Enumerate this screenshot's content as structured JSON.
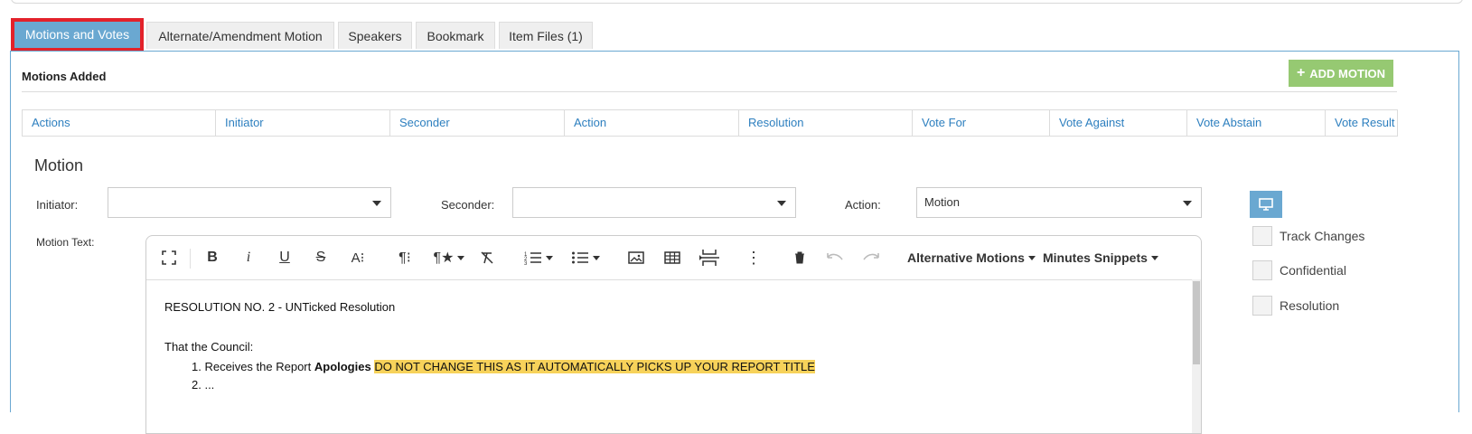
{
  "tabs": [
    {
      "label": "Motions and Votes",
      "active": true
    },
    {
      "label": "Alternate/Amendment Motion"
    },
    {
      "label": "Speakers"
    },
    {
      "label": "Bookmark"
    },
    {
      "label": "Item Files (1)"
    }
  ],
  "motions_added": {
    "title": "Motions Added",
    "add_button": "ADD MOTION",
    "columns": [
      "Actions",
      "Initiator",
      "Seconder",
      "Action",
      "Resolution",
      "Vote For",
      "Vote Against",
      "Vote Abstain",
      "Vote Result"
    ]
  },
  "motion": {
    "title": "Motion",
    "initiator_label": "Initiator:",
    "initiator_value": "",
    "seconder_label": "Seconder:",
    "seconder_value": "",
    "action_label": "Action:",
    "action_value": "Motion",
    "text_label": "Motion Text:"
  },
  "toolbar": {
    "alternative_motions": "Alternative Motions",
    "minutes_snippets": "Minutes Snippets",
    "icons": [
      "fullscreen-icon",
      "bold-icon",
      "italic-icon",
      "underline-icon",
      "strikethrough-icon",
      "font-size-icon",
      "paragraph-format-icon",
      "paragraph-style-icon",
      "clear-formatting-icon",
      "ordered-list-icon",
      "unordered-list-icon",
      "image-icon",
      "table-icon",
      "page-break-icon",
      "more-icon",
      "trash-icon",
      "undo-icon",
      "redo-icon"
    ]
  },
  "editor_content": {
    "line1": "RESOLUTION  NO. 2 - UNTicked Resolution",
    "line2": "That the Council:",
    "item1_prefix": "1. Receives the Report ",
    "item1_bold": "Apologies",
    "item1_highlight": "DO NOT CHANGE THIS AS IT AUTOMATICALLY PICKS UP YOUR REPORT TITLE",
    "item2": "2. ..."
  },
  "options": {
    "track_changes": "Track Changes",
    "confidential": "Confidential",
    "resolution": "Resolution"
  },
  "colors": {
    "accent": "#6aa8d1",
    "add_button": "#96c972",
    "highlight": "#f7d25a",
    "active_outline": "#e3222a"
  }
}
